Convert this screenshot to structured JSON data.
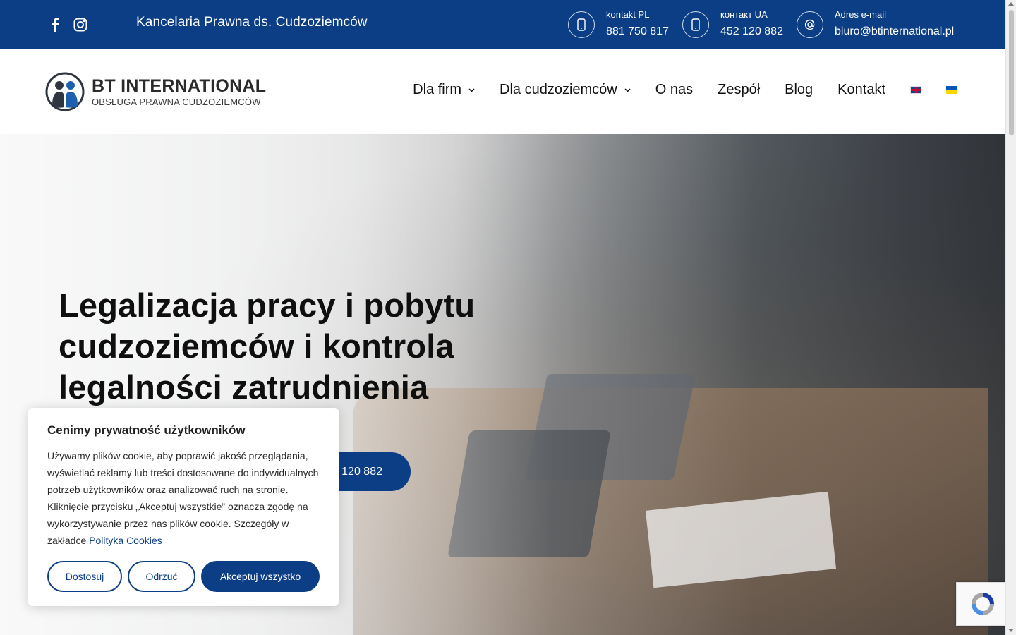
{
  "topbar": {
    "tagline": "Kancelaria Prawna ds. Cudzoziemców",
    "social": [
      {
        "icon": "facebook-icon"
      },
      {
        "icon": "instagram-icon"
      }
    ],
    "contacts": [
      {
        "label": "kontakt PL",
        "value": "881 750 817",
        "icon": "phone-icon"
      },
      {
        "label": "контакт UA",
        "value": "452 120 882",
        "icon": "phone-icon"
      },
      {
        "label": "Adres e-mail",
        "value": "biuro@btinternational.pl",
        "icon": "at-icon"
      }
    ],
    "background": "#0c3e86"
  },
  "header": {
    "logo_title": "BT INTERNATIONAL",
    "logo_subtitle": "OBSŁUGA PRAWNA CUDZOZIEMCÓW",
    "nav": [
      {
        "label": "Dla firm",
        "has_dropdown": true
      },
      {
        "label": "Dla cudzoziemców",
        "has_dropdown": true
      },
      {
        "label": "O nas",
        "has_dropdown": false
      },
      {
        "label": "Zespół",
        "has_dropdown": false
      },
      {
        "label": "Blog",
        "has_dropdown": false
      },
      {
        "label": "Kontakt",
        "has_dropdown": false
      }
    ],
    "languages": [
      {
        "icon": "uk-flag-icon"
      },
      {
        "icon": "ua-flag-icon"
      }
    ]
  },
  "hero": {
    "heading": "Legalizacja pracy i pobytu cudzoziemców i kontrola legalności zatrudnienia",
    "cta_partial": "120 882"
  },
  "cookie": {
    "title": "Cenimy prywatność użytkowników",
    "body": "Używamy plików cookie, aby poprawić jakość przeglądania, wyświetlać reklamy lub treści dostosowane do indywidualnych potrzeb użytkowników oraz analizować ruch na stronie. Kliknięcie przycisku „Akceptuj wszystkie” oznacza zgodę na wykorzystywanie przez nas plików cookie. Szczegóły w zakładce",
    "link": "Polityka Cookies",
    "buttons": {
      "customize": "Dostosuj",
      "reject": "Odrzuć",
      "accept": "Akceptuj wszystko"
    }
  },
  "colors": {
    "brand": "#0c3e86"
  }
}
